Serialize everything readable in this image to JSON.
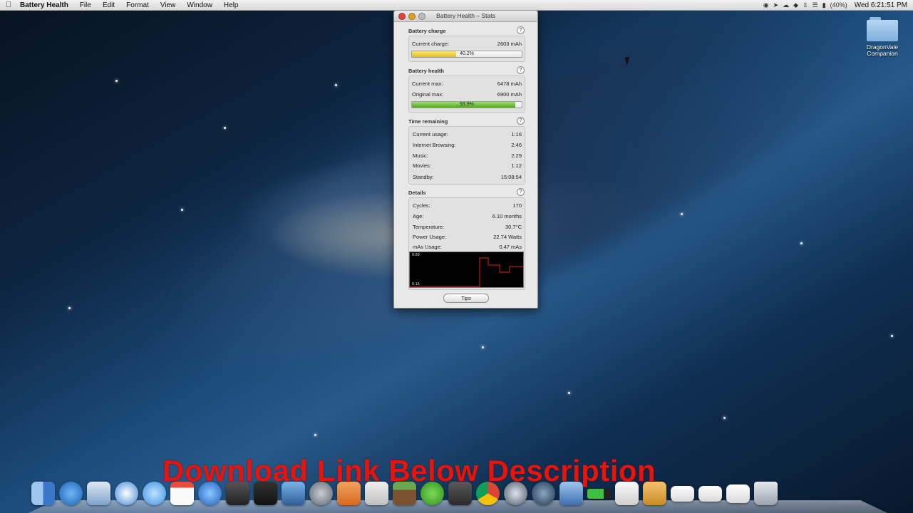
{
  "menubar": {
    "apple_icon": "apple-icon",
    "app_name": "Battery Health",
    "items": [
      "File",
      "Edit",
      "Format",
      "View",
      "Window",
      "Help"
    ],
    "battery_percent": "(40%)",
    "clock": "Wed 6:21:51 PM"
  },
  "window": {
    "title": "Battery Health – Stats",
    "battery_charge": {
      "header": "Battery charge",
      "current_charge_label": "Current charge:",
      "current_charge_value": "2603 mAh",
      "percent_label": "40.2%",
      "percent": 40.2
    },
    "battery_health": {
      "header": "Battery health",
      "current_max_label": "Current max:",
      "current_max_value": "6478 mAh",
      "original_max_label": "Original max:",
      "original_max_value": "6900 mAh",
      "percent_label": "93.9%",
      "percent": 93.9
    },
    "time_remaining": {
      "header": "Time remaining",
      "rows": [
        {
          "label": "Current usage:",
          "value": "1:16"
        },
        {
          "label": "Internet Browsing:",
          "value": "2:46"
        },
        {
          "label": "Music:",
          "value": "2:29"
        },
        {
          "label": "Movies:",
          "value": "1:12"
        },
        {
          "label": "Standby:",
          "value": "15:08:54"
        }
      ]
    },
    "details": {
      "header": "Details",
      "rows": [
        {
          "label": "Cycles:",
          "value": "170"
        },
        {
          "label": "Age:",
          "value": "6.10 months"
        },
        {
          "label": "Temperature:",
          "value": "30.7°C"
        },
        {
          "label": "Power Usage:",
          "value": "22.74 Watts"
        },
        {
          "label": "mAs Usage:",
          "value": "0.47 mAs"
        }
      ],
      "graph_max_label": "0.89",
      "graph_min_label": "0.15"
    },
    "tips_button": "Tips",
    "help_glyph": "?"
  },
  "desktop": {
    "folder_name": "DragonVale Companion"
  },
  "overlay_text": "Download Link Below Description",
  "dock": {
    "icons": [
      "finder-icon",
      "app-store-icon",
      "mail-icon",
      "safari-icon",
      "messages-icon",
      "calendar-icon",
      "itunes-icon",
      "photo-booth-icon",
      "preview-icon",
      "iphoto-icon",
      "system-preferences-icon",
      "textedit-icon",
      "charts-icon",
      "minecraft-icon",
      "spotify-icon",
      "steam-icon",
      "chrome-icon",
      "activity-monitor-icon",
      "compass-icon",
      "xcode-icon",
      "battery-health-icon",
      "document-icon",
      "package-icon",
      "window-icon",
      "window-icon-2",
      "window-icon-3",
      "trash-icon"
    ]
  },
  "colors": {
    "charge_bar": "#e4bd16",
    "health_bar": "#52a61f",
    "overlay_text": "#e8140c",
    "graph_line": "#e02020"
  }
}
